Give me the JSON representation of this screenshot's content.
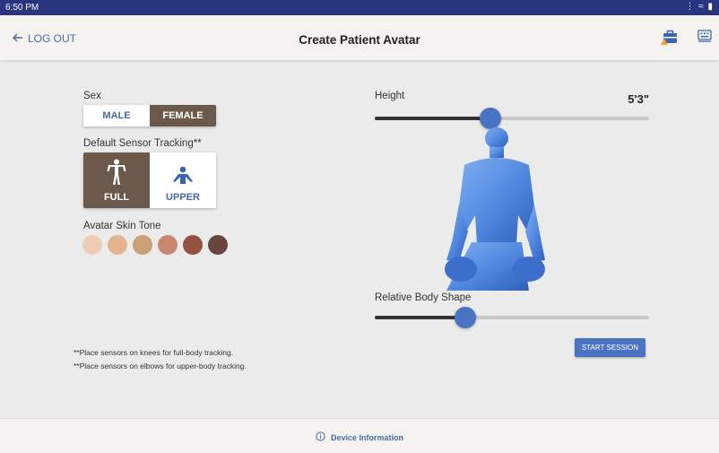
{
  "status_bar": {
    "time": "6:50 PM",
    "indicators": "⋮ ≈ ▮"
  },
  "header": {
    "logout_label": "LOG OUT",
    "title": "Create Patient Avatar",
    "icons": [
      "briefcase-alert-icon",
      "keyboard-icon"
    ]
  },
  "sex": {
    "label": "Sex",
    "options": [
      "MALE",
      "FEMALE"
    ],
    "selected": "FEMALE"
  },
  "tracking": {
    "label": "Default Sensor Tracking**",
    "options": [
      "FULL",
      "UPPER"
    ],
    "selected": "FULL"
  },
  "skin_tone": {
    "label": "Avatar Skin Tone",
    "colors": [
      "#efcdb4",
      "#e3b48f",
      "#c9a078",
      "#c98772",
      "#94513f",
      "#6a4540"
    ]
  },
  "height": {
    "label": "Height",
    "value": "5'3\"",
    "slider_fraction": 0.42
  },
  "body_shape": {
    "label": "Relative Body Shape",
    "slider_fraction": 0.33
  },
  "notes": [
    "**Place sensors on knees for full-body tracking.",
    "**Place sensors on elbows for upper-body tracking."
  ],
  "start_session_label": "START SESSION",
  "footer": {
    "device_info_label": "Device Information",
    "icon": "info-icon"
  },
  "colors": {
    "accent": "#4a74c2",
    "selected": "#6b5a4c",
    "link": "#4a6aa3",
    "status_bar": "#2a3580",
    "avatar": "#5b8fe0"
  }
}
